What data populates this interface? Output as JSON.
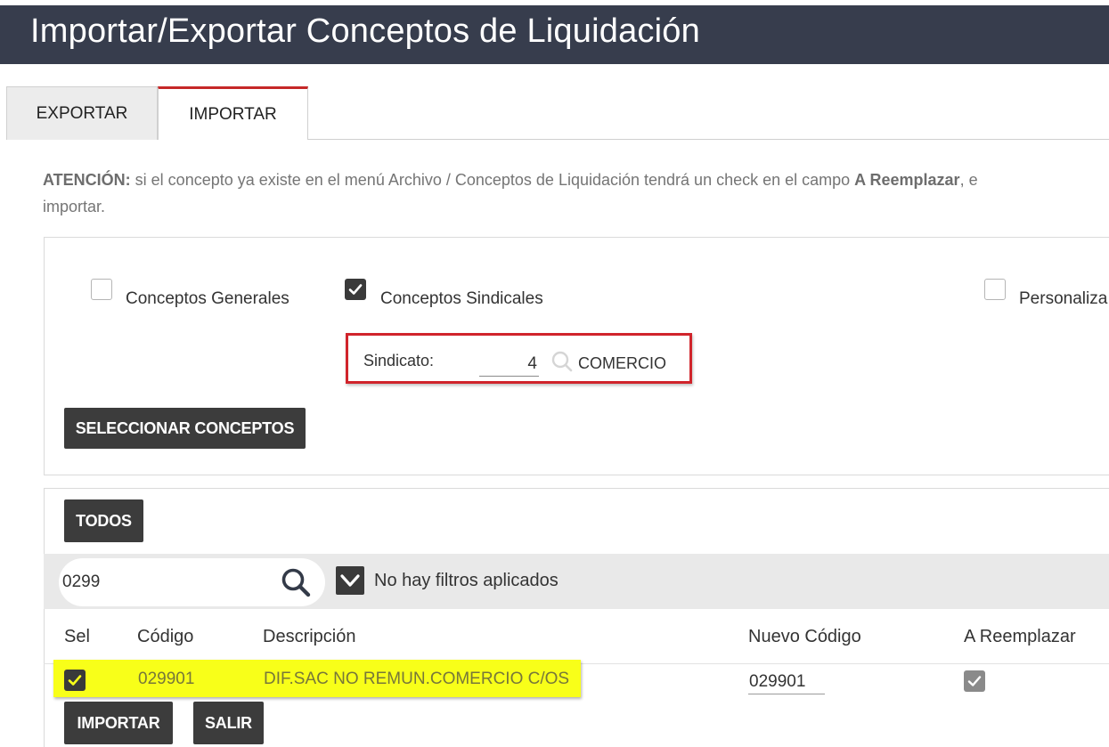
{
  "header": {
    "title": "Importar/Exportar Conceptos de Liquidación"
  },
  "tabs": [
    {
      "label": "EXPORTAR",
      "active": false
    },
    {
      "label": "IMPORTAR",
      "active": true
    }
  ],
  "notice": {
    "prefix": "ATENCIÓN:",
    "text1": " si el concepto ya existe en el menú Archivo / Conceptos de Liquidación tendrá un check en el campo ",
    "field": "A Reemplazar",
    "text2": ", e",
    "line2": "importar."
  },
  "options": {
    "generales": {
      "label": "Conceptos Generales",
      "checked": false
    },
    "sindicales": {
      "label": "Conceptos Sindicales",
      "checked": true
    },
    "personalizados": {
      "label": "Personaliza",
      "checked": false
    }
  },
  "sindicato": {
    "label": "Sindicato:",
    "value": "4",
    "name": "COMERCIO"
  },
  "buttons": {
    "seleccionar": "SELECCIONAR CONCEPTOS",
    "todos": "TODOS",
    "importar": "IMPORTAR",
    "salir": "SALIR"
  },
  "search": {
    "value": "0299",
    "filter_status": "No hay filtros aplicados"
  },
  "table": {
    "headers": {
      "sel": "Sel",
      "codigo": "Código",
      "descripcion": "Descripción",
      "nuevo": "Nuevo Código",
      "reemplazar": "A Reemplazar"
    },
    "rows": [
      {
        "selected": true,
        "codigo": "029901",
        "descripcion": "DIF.SAC NO REMUN.COMERCIO C/OS",
        "nuevo_codigo": "029901",
        "reemplazar": true
      }
    ]
  },
  "colors": {
    "header_bg": "#373d4d",
    "tab_accent": "#c62828",
    "highlight": "#f8ff19",
    "callout_border": "#d0242b",
    "button_bg": "#3c3c3c"
  },
  "icons": [
    "search-icon",
    "check-icon",
    "chevron-down-icon",
    "magnifier-icon"
  ]
}
